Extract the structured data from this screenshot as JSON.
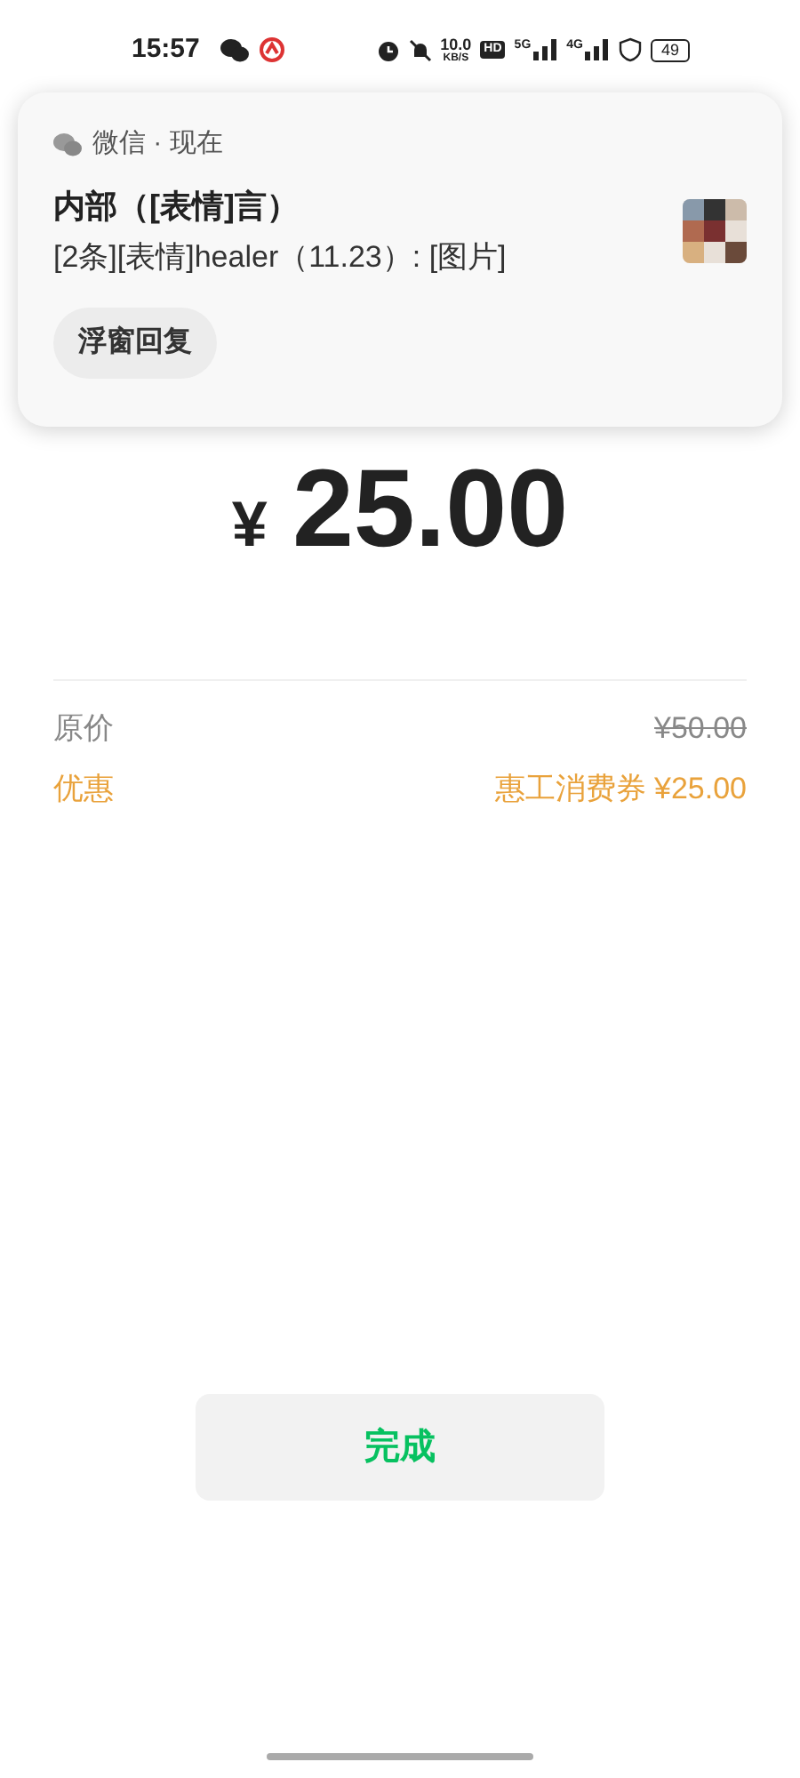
{
  "status_bar": {
    "time": "15:57",
    "speed": "10.0",
    "speed_unit": "KB/S",
    "hd": "HD",
    "net1": "5G",
    "net2": "4G",
    "battery": "49"
  },
  "notification": {
    "app": "微信 · 现在",
    "title": "内部（[表情]言）",
    "message": "[2条][表情]healer（11.23）: [图片]",
    "action": "浮窗回复"
  },
  "amount": {
    "currency": "¥",
    "value": "25.00"
  },
  "rows": [
    {
      "kind": "original",
      "label": "原价",
      "value": "¥50.00"
    },
    {
      "kind": "discount",
      "label": "优惠",
      "value": "惠工消费券 ¥25.00"
    }
  ],
  "done_button": "完成"
}
